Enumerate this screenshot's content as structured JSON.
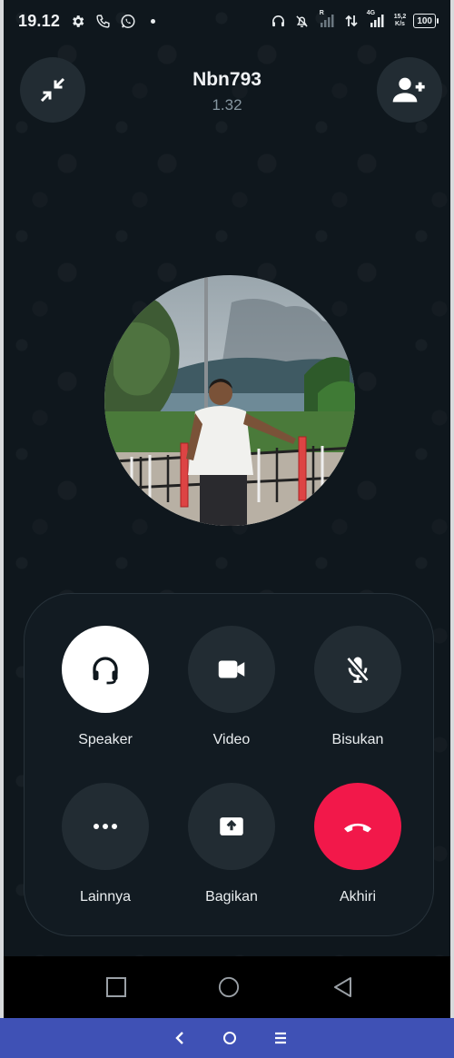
{
  "status_bar": {
    "time": "19.12",
    "network_speed_value": "15,2",
    "network_speed_unit": "K/s",
    "network_type": "4G",
    "roaming_indicator": "R",
    "battery": "100",
    "left_icons": [
      "gear-icon",
      "phone-icon",
      "whatsapp-icon",
      "dot"
    ],
    "right_icons": [
      "headset-icon",
      "alarm-off-icon",
      "signal-icon",
      "data-transfer-icon",
      "signal-icon",
      "battery-icon"
    ]
  },
  "call": {
    "contact_name": "Nbn793",
    "timer": "1.32",
    "minimize_icon": "minimize-icon",
    "add_participant_icon": "add-person-icon"
  },
  "controls": [
    {
      "label": "Speaker",
      "icon": "headset-icon",
      "state": "active"
    },
    {
      "label": "Video",
      "icon": "video-camera-icon",
      "state": "inactive"
    },
    {
      "label": "Bisukan",
      "icon": "mic-off-icon",
      "state": "inactive"
    },
    {
      "label": "Lainnya",
      "icon": "more-icon",
      "state": "inactive"
    },
    {
      "label": "Bagikan",
      "icon": "share-screen-icon",
      "state": "inactive"
    },
    {
      "label": "Akhiri",
      "icon": "end-call-icon",
      "state": "danger"
    }
  ],
  "android_nav": [
    "recents-icon",
    "home-icon",
    "back-icon"
  ],
  "host_nav": [
    "chevron-left-icon",
    "circle-home-icon",
    "menu-icon"
  ],
  "colors": {
    "background": "#0f171d",
    "button_bg": "#222c33",
    "active_button": "#ffffff",
    "end_call": "#f2184a",
    "host_nav": "#3f51b5"
  }
}
